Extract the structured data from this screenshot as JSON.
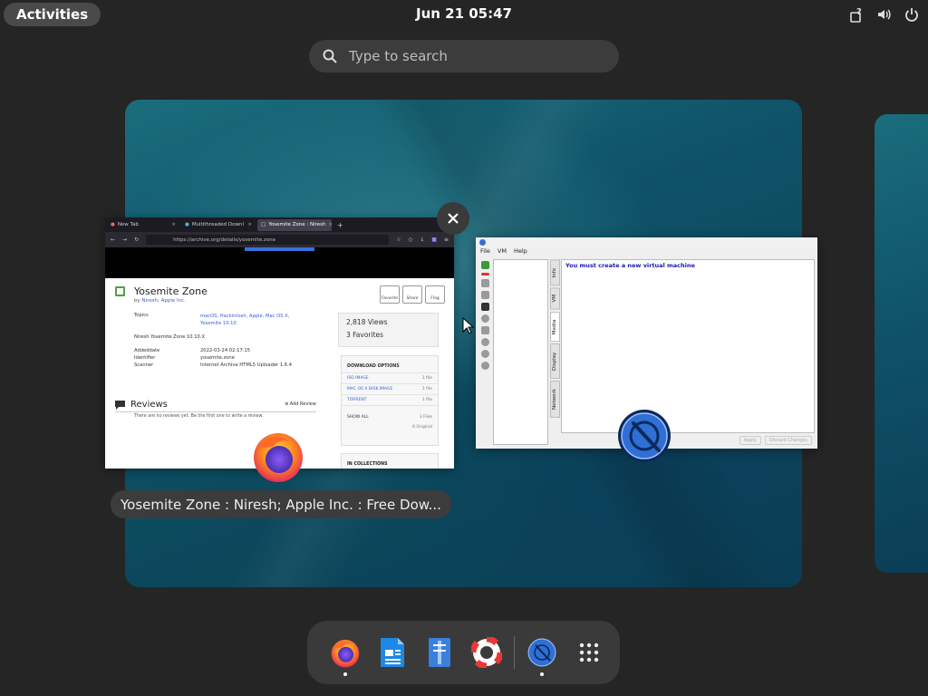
{
  "topbar": {
    "activities_label": "Activities",
    "clock": "Jun 21  05:47",
    "tray_icons": [
      "accessibility-icon",
      "volume-icon",
      "power-icon"
    ]
  },
  "search": {
    "placeholder": "Type to search"
  },
  "windows": {
    "firefox": {
      "caption": "Yosemite Zone : Niresh; Apple Inc. : Free Dow...",
      "tabs": [
        {
          "label": "New Tab",
          "close": "×"
        },
        {
          "label": "Multithreaded Downl",
          "close": "×"
        },
        {
          "label": "Yosemite Zone : Niresh",
          "close": "×"
        }
      ],
      "new_tab": "+",
      "url": "https://archive.org/details/yosemite.zone",
      "page": {
        "title": "Yosemite Zone",
        "by_prefix": "by",
        "by_link": "Niresh; Apple Inc.",
        "actions": [
          "Favorite",
          "Share",
          "Flag"
        ],
        "topics_label": "Topics",
        "topics_value": "macOS, Hackintosh, Apple, Mac OS X, Yosemite 10.10",
        "description": "Niresh Yosemite Zone 10.10.X",
        "addeddate_label": "Addeddate",
        "addeddate_value": "2022-03-24 02:17:15",
        "identifier_label": "Identifier",
        "identifier_value": "yosemite.zone",
        "scanner_label": "Scanner",
        "scanner_value": "Internet Archive HTML5 Uploader 1.6.4",
        "views": "2,818 Views",
        "favorites": "3 Favorites",
        "download_header": "DOWNLOAD OPTIONS",
        "downloads": [
          {
            "name": "ISO IMAGE",
            "count": "1 file"
          },
          {
            "name": "MAC OS X DISK IMAGE",
            "count": "1 file"
          },
          {
            "name": "TORRENT",
            "count": "1 file"
          }
        ],
        "show_all": "SHOW ALL",
        "files_count": "3 Files",
        "original_count": "6 Original",
        "collections_header": "IN COLLECTIONS",
        "reviews_title": "Reviews",
        "add_review": "Add Review",
        "no_reviews": "There are no reviews yet. Be the first one to write a review."
      }
    },
    "vm": {
      "menu": [
        "File",
        "VM",
        "Help"
      ],
      "tabs": [
        "Info",
        "VM",
        "Media",
        "Display",
        "Network"
      ],
      "message": "You must create a new virtual machine",
      "buttons": [
        "Apply",
        "Discard Changes"
      ]
    }
  },
  "dash": {
    "apps": [
      {
        "name": "firefox",
        "running": true
      },
      {
        "name": "writer",
        "running": false
      },
      {
        "name": "text-editor",
        "running": false
      },
      {
        "name": "help",
        "running": false
      },
      {
        "name": "vm-manager",
        "running": true
      },
      {
        "name": "app-grid",
        "running": false
      }
    ]
  },
  "colors": {
    "panel": "#252525",
    "pill": "#3c3c3c",
    "wallpaper": "#0f5369"
  }
}
